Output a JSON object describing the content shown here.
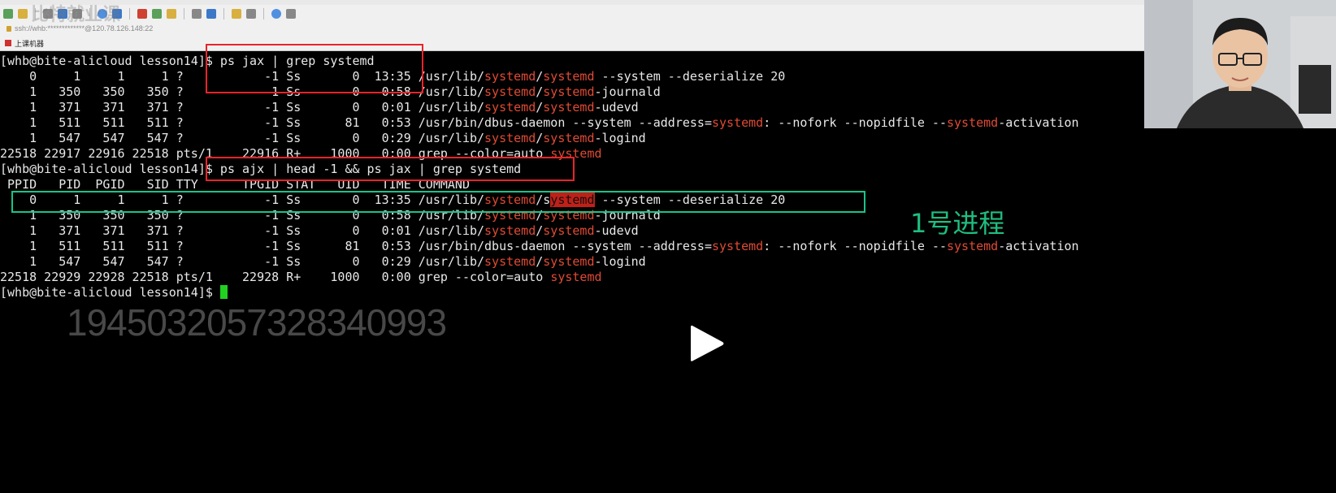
{
  "app": {
    "address": "ssh://whb:*************@120.78.126.148:22",
    "bookmark": "上课机器",
    "logo_text": "比特就业课"
  },
  "terminal": {
    "lines": [
      {
        "parts": [
          {
            "t": "[whb@bite-alicloud lesson14]$ ps jax | grep systemd"
          }
        ]
      },
      {
        "parts": [
          {
            "t": "    0     1     1     1 ?           -1 Ss       0  13:35 /usr/lib/"
          },
          {
            "t": "systemd",
            "c": "hl"
          },
          {
            "t": "/"
          },
          {
            "t": "systemd",
            "c": "hl"
          },
          {
            "t": " --system --deserialize 20"
          }
        ]
      },
      {
        "parts": [
          {
            "t": "    1   350   350   350 ?           -1 Ss       0   0:58 /usr/lib/"
          },
          {
            "t": "systemd",
            "c": "hl"
          },
          {
            "t": "/"
          },
          {
            "t": "systemd",
            "c": "hl"
          },
          {
            "t": "-journald"
          }
        ]
      },
      {
        "parts": [
          {
            "t": "    1   371   371   371 ?           -1 Ss       0   0:01 /usr/lib/"
          },
          {
            "t": "systemd",
            "c": "hl"
          },
          {
            "t": "/"
          },
          {
            "t": "systemd",
            "c": "hl"
          },
          {
            "t": "-udevd"
          }
        ]
      },
      {
        "parts": [
          {
            "t": "    1   511   511   511 ?           -1 Ss      81   0:53 /usr/bin/dbus-daemon --system --address="
          },
          {
            "t": "systemd",
            "c": "hl"
          },
          {
            "t": ": --nofork --nopidfile --"
          },
          {
            "t": "systemd",
            "c": "hl"
          },
          {
            "t": "-activation"
          }
        ]
      },
      {
        "parts": [
          {
            "t": "    1   547   547   547 ?           -1 Ss       0   0:29 /usr/lib/"
          },
          {
            "t": "systemd",
            "c": "hl"
          },
          {
            "t": "/"
          },
          {
            "t": "systemd",
            "c": "hl"
          },
          {
            "t": "-logind"
          }
        ]
      },
      {
        "parts": [
          {
            "t": "22518 22917 22916 22518 pts/1    22916 R+    1000   0:00 grep --color=auto "
          },
          {
            "t": "systemd",
            "c": "hl"
          }
        ]
      },
      {
        "parts": [
          {
            "t": "[whb@bite-alicloud lesson14]$ ps ajx | head -1 && ps jax | grep systemd"
          }
        ]
      },
      {
        "parts": [
          {
            "t": " PPID   PID  PGID   SID TTY      TPGID STAT   UID   TIME COMMAND"
          }
        ]
      },
      {
        "parts": [
          {
            "t": "    0     1     1     1 ?           -1 Ss       0  13:35 /usr/lib/"
          },
          {
            "t": "systemd",
            "c": "hl"
          },
          {
            "t": "/s"
          },
          {
            "t": "ystemd",
            "c": "hlbg2"
          },
          {
            "t": " --system --deserialize 20"
          }
        ]
      },
      {
        "parts": [
          {
            "t": "    1   350   350   350 ?           -1 Ss       0   0:58 /usr/lib/"
          },
          {
            "t": "systemd",
            "c": "hl"
          },
          {
            "t": "/"
          },
          {
            "t": "systemd",
            "c": "hl"
          },
          {
            "t": "-journald"
          }
        ]
      },
      {
        "parts": [
          {
            "t": "    1   371   371   371 ?           -1 Ss       0   0:01 /usr/lib/"
          },
          {
            "t": "systemd",
            "c": "hl"
          },
          {
            "t": "/"
          },
          {
            "t": "systemd",
            "c": "hl"
          },
          {
            "t": "-udevd"
          }
        ]
      },
      {
        "parts": [
          {
            "t": "    1   511   511   511 ?           -1 Ss      81   0:53 /usr/bin/dbus-daemon --system --address="
          },
          {
            "t": "systemd",
            "c": "hl"
          },
          {
            "t": ": --nofork --nopidfile --"
          },
          {
            "t": "systemd",
            "c": "hl"
          },
          {
            "t": "-activation"
          }
        ]
      },
      {
        "parts": [
          {
            "t": "    1   547   547   547 ?           -1 Ss       0   0:29 /usr/lib/"
          },
          {
            "t": "systemd",
            "c": "hl"
          },
          {
            "t": "/"
          },
          {
            "t": "systemd",
            "c": "hl"
          },
          {
            "t": "-logind"
          }
        ]
      },
      {
        "parts": [
          {
            "t": "22518 22929 22928 22518 pts/1    22928 R+    1000   0:00 grep --color=auto "
          },
          {
            "t": "systemd",
            "c": "hl"
          }
        ]
      },
      {
        "parts": [
          {
            "t": "[whb@bite-alicloud lesson14]$ "
          }
        ],
        "cursor": true
      }
    ]
  },
  "annotation": {
    "label": "1号进程"
  },
  "overlay": {
    "watermark_id": "1945032057328340993"
  },
  "colors": {
    "highlight": "#e04a34",
    "red_box": "#e8242a",
    "green_box": "#18c48a",
    "cursor": "#21d021"
  },
  "icons": [
    "play-icon",
    "lock-icon",
    "bookmark-flag-icon"
  ]
}
